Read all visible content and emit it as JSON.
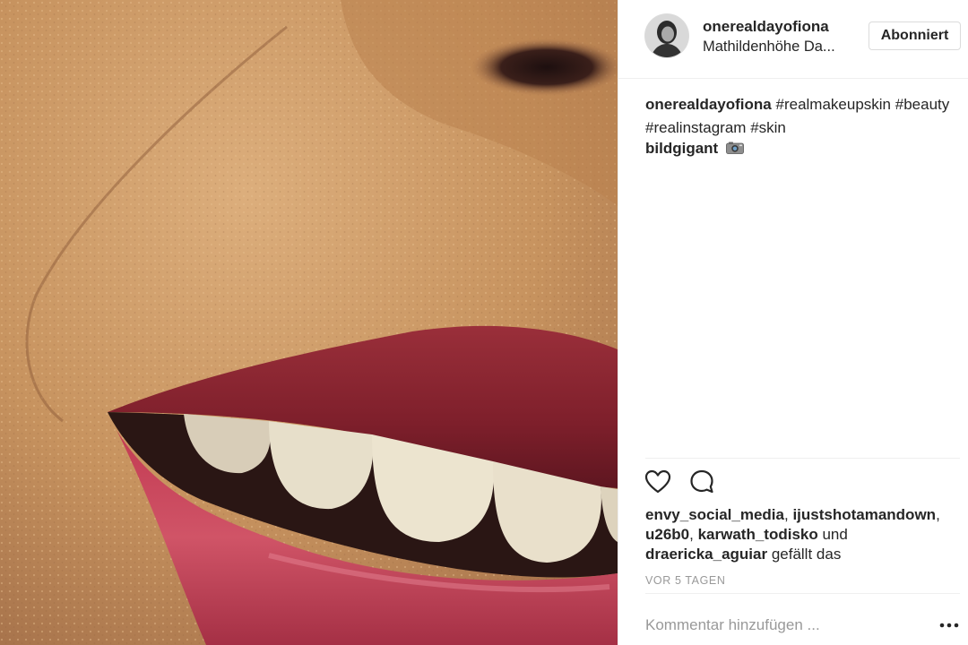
{
  "post": {
    "username": "onerealdayofiona",
    "location": "Mathildenhöhe Da...",
    "follow_label": "Abonniert",
    "caption": {
      "username": "onerealdayofiona",
      "hashtags": [
        "#realmakeupskin",
        "#beauty",
        "#realinstagram",
        "#skin"
      ]
    },
    "comments": [
      {
        "username": "bildgigant",
        "emoji": "camera-emoji"
      }
    ],
    "likes": {
      "users": [
        "envy_social_media",
        "ijustshotamandown",
        "u26b0",
        "karwath_todisko",
        "draericka_aguiar"
      ],
      "separator_1": ", ",
      "connector": " und ",
      "suffix": " gefällt das"
    },
    "timestamp": "VOR 5 TAGEN",
    "comment_input": {
      "placeholder": "Kommentar hinzufügen ..."
    },
    "icons": {
      "like": "heart-icon",
      "comment": "speech-bubble-icon",
      "more": "more-options-icon"
    },
    "colors": {
      "text": "#262626",
      "muted": "#999999",
      "divider": "#efefef",
      "lip": "#a5283a",
      "skin": "#c9955f"
    }
  }
}
